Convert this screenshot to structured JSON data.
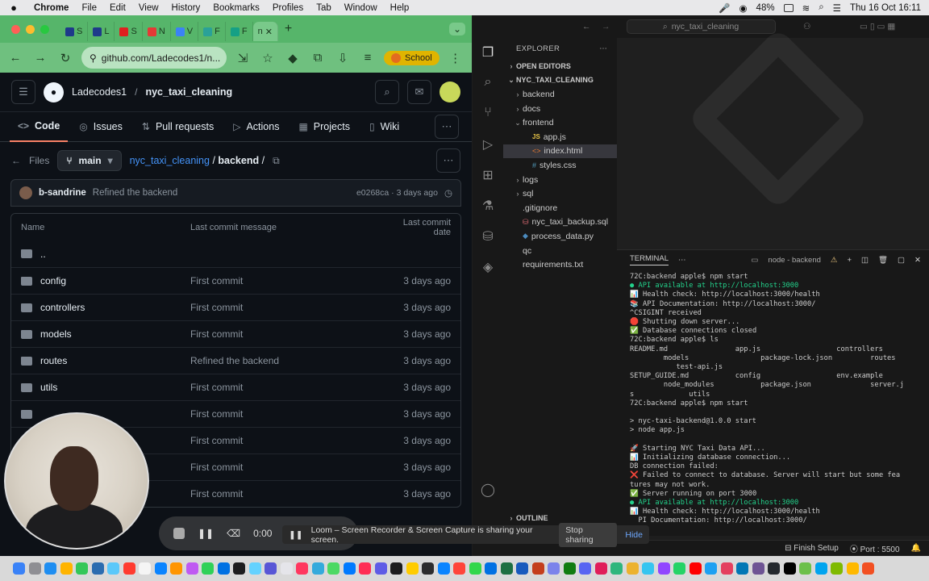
{
  "menubar": {
    "app": "Chrome",
    "items": [
      "File",
      "Edit",
      "View",
      "History",
      "Bookmarks",
      "Profiles",
      "Tab",
      "Window",
      "Help"
    ],
    "battery": "48%",
    "datetime": "Thu 16 Oct  16:11"
  },
  "chrome": {
    "tabs": [
      {
        "label": "S",
        "color": "#1e3a8a"
      },
      {
        "label": "L",
        "color": "#1e3a8a"
      },
      {
        "label": "S",
        "color": "#e02020"
      },
      {
        "label": "N",
        "color": "#e53935"
      },
      {
        "label": "V",
        "color": "#3b82f6"
      },
      {
        "label": "F",
        "color": "#2aa198"
      },
      {
        "label": "F",
        "color": "#16a085"
      }
    ],
    "active_tab": "n",
    "url": "github.com/Ladecodes1/n...",
    "profile": "School"
  },
  "github": {
    "owner": "Ladecodes1",
    "repo": "nyc_taxi_cleaning",
    "nav": [
      {
        "label": "Code",
        "icon": "<>"
      },
      {
        "label": "Issues",
        "icon": "◎"
      },
      {
        "label": "Pull requests",
        "icon": "⇅"
      },
      {
        "label": "Actions",
        "icon": "▷"
      },
      {
        "label": "Projects",
        "icon": "▦"
      },
      {
        "label": "Wiki",
        "icon": "▯"
      }
    ],
    "files_label": "Files",
    "branch": "main",
    "breadcrumb_repo": "nyc_taxi_cleaning",
    "breadcrumb_folder": "backend",
    "commit": {
      "author": "b-sandrine",
      "message": "Refined the backend",
      "meta": "e0268ca · 3 days ago"
    },
    "table_headers": {
      "name": "Name",
      "message": "Last commit message",
      "date": "Last commit date"
    },
    "rows": [
      {
        "name": "..",
        "message": "",
        "date": ""
      },
      {
        "name": "config",
        "message": "First commit",
        "date": "3 days ago"
      },
      {
        "name": "controllers",
        "message": "First commit",
        "date": "3 days ago"
      },
      {
        "name": "models",
        "message": "First commit",
        "date": "3 days ago"
      },
      {
        "name": "routes",
        "message": "Refined the backend",
        "date": "3 days ago"
      },
      {
        "name": "utils",
        "message": "First commit",
        "date": "3 days ago"
      },
      {
        "name": "",
        "message": "First commit",
        "date": "3 days ago"
      },
      {
        "name": "",
        "message": "First commit",
        "date": "3 days ago"
      },
      {
        "name": "",
        "message": "First commit",
        "date": "3 days ago"
      },
      {
        "name": "",
        "message": "First commit",
        "date": "3 days ago"
      }
    ]
  },
  "recorder": {
    "time": "0:00"
  },
  "vscode": {
    "search": "nyc_taxi_cleaning",
    "explorer_title": "EXPLORER",
    "open_editors": "OPEN EDITORS",
    "project": "NYC_TAXI_CLEANING",
    "tree": [
      {
        "label": "backend",
        "type": "folder",
        "depth": 1,
        "open": false
      },
      {
        "label": "docs",
        "type": "folder",
        "depth": 1,
        "open": false
      },
      {
        "label": "frontend",
        "type": "folder",
        "depth": 1,
        "open": true
      },
      {
        "label": "app.js",
        "type": "js",
        "depth": 2
      },
      {
        "label": "index.html",
        "type": "html",
        "depth": 2,
        "selected": true
      },
      {
        "label": "styles.css",
        "type": "css",
        "depth": 2
      },
      {
        "label": "logs",
        "type": "folder",
        "depth": 1,
        "open": false
      },
      {
        "label": "sql",
        "type": "folder",
        "depth": 1,
        "open": false
      },
      {
        "label": ".gitignore",
        "type": "file",
        "depth": 1
      },
      {
        "label": "nyc_taxi_backup.sql",
        "type": "db",
        "depth": 1
      },
      {
        "label": "process_data.py",
        "type": "py",
        "depth": 1
      },
      {
        "label": "qc",
        "type": "file",
        "depth": 1
      },
      {
        "label": "requirements.txt",
        "type": "file",
        "depth": 1
      }
    ],
    "outline": "OUTLINE",
    "terminal_tab": "TERMINAL",
    "terminal_name": "node - backend",
    "terminal_lines": [
      {
        "t": "72C:backend apple$ npm start",
        "c": ""
      },
      {
        "t": "● API available at http://localhost:3000",
        "c": "g"
      },
      {
        "t": "📊 Health check: http://localhost:3000/health",
        "c": ""
      },
      {
        "t": "📚 API Documentation: http://localhost:3000/",
        "c": ""
      },
      {
        "t": "^CSIGINT received",
        "c": ""
      },
      {
        "t": "🛑 Shutting down server...",
        "c": ""
      },
      {
        "t": "✅ Database connections closed",
        "c": ""
      },
      {
        "t": "72C:backend apple$ ls",
        "c": ""
      },
      {
        "t": "README.md                app.js                  controllers",
        "c": ""
      },
      {
        "t": "        models                 package-lock.json         routes",
        "c": ""
      },
      {
        "t": "           test-api.js",
        "c": ""
      },
      {
        "t": "SETUP_GUIDE.md           config                  env.example",
        "c": ""
      },
      {
        "t": "        node_modules           package.json              server.j",
        "c": ""
      },
      {
        "t": "s             utils",
        "c": ""
      },
      {
        "t": "72C:backend apple$ npm start",
        "c": ""
      },
      {
        "t": "",
        "c": ""
      },
      {
        "t": "> nyc-taxi-backend@1.0.0 start",
        "c": ""
      },
      {
        "t": "> node app.js",
        "c": ""
      },
      {
        "t": "",
        "c": ""
      },
      {
        "t": "🚀 Starting NYC Taxi Data API...",
        "c": ""
      },
      {
        "t": "📊 Initializing database connection...",
        "c": ""
      },
      {
        "t": "DB connection failed:",
        "c": ""
      },
      {
        "t": "❌ Failed to connect to database. Server will start but some fea",
        "c": ""
      },
      {
        "t": "tures may not work.",
        "c": ""
      },
      {
        "t": "✅ Server running on port 3000",
        "c": ""
      },
      {
        "t": "● API available at http://localhost:3000",
        "c": "g"
      },
      {
        "t": "📊 Health check: http://localhost:3000/health",
        "c": ""
      },
      {
        "t": "  PI Documentation: http://localhost:3000/",
        "c": ""
      }
    ],
    "status": {
      "finish": "Finish Setup",
      "port": "Port : 5500"
    }
  },
  "loom": {
    "message": "Loom – Screen Recorder & Screen Capture is sharing your screen.",
    "stop": "Stop sharing",
    "hide": "Hide"
  },
  "dock_colors": [
    "#3a82f7",
    "#8e8e93",
    "#1f8ef1",
    "#ffb400",
    "#34c759",
    "#2b6cb0",
    "#5ac8fa",
    "#ff3b30",
    "#f5f5f5",
    "#0a84ff",
    "#ff9500",
    "#bf5af2",
    "#30d158",
    "#0071e3",
    "#1d1d1f",
    "#64d2ff",
    "#5856d6",
    "#e5e5ea",
    "#ff375f",
    "#34aadc",
    "#4cd964",
    "#007aff",
    "#ff2d55",
    "#5e5ce6",
    "#1c1c1e",
    "#ffcc00",
    "#2c2c2e",
    "#0a84ff",
    "#ff453a",
    "#32d74b",
    "#0071e3",
    "#1d6f42",
    "#185abd",
    "#c43e1c",
    "#7b83eb",
    "#107c10",
    "#5865f2",
    "#e01e5a",
    "#2eb67d",
    "#ecb22e",
    "#36c5f0",
    "#9146ff",
    "#25d366",
    "#ff0000",
    "#1da1f2",
    "#e4405f",
    "#0077b5",
    "#6e5494",
    "#24292e",
    "#000000",
    "#6cc04a",
    "#00a4ef",
    "#7fba00",
    "#ffb900",
    "#f25022"
  ]
}
